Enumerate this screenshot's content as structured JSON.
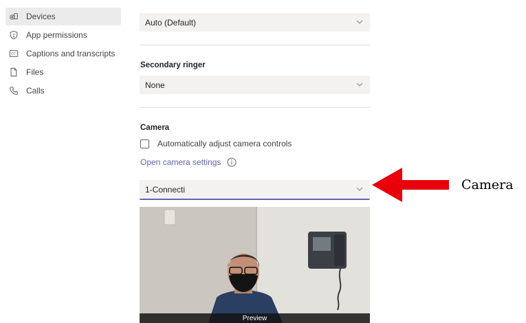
{
  "sidebar": {
    "items": [
      {
        "label": "Devices",
        "icon": "device-icon",
        "active": true
      },
      {
        "label": "App permissions",
        "icon": "shield-icon"
      },
      {
        "label": "Captions and transcripts",
        "icon": "captions-icon"
      },
      {
        "label": "Files",
        "icon": "file-icon"
      },
      {
        "label": "Calls",
        "icon": "phone-icon"
      }
    ]
  },
  "main": {
    "ringer_select": {
      "value": "Auto (Default)"
    },
    "secondary_ringer": {
      "title": "Secondary ringer",
      "value": "None"
    },
    "camera": {
      "title": "Camera",
      "auto_adjust_label": "Automatically adjust camera controls",
      "auto_adjust_checked": false,
      "open_settings_link": "Open camera settings",
      "device_value": "1-Connecti",
      "preview_label": "Preview"
    }
  },
  "annotation": {
    "label": "Camera",
    "arrow_color": "#e8000b"
  },
  "colors": {
    "accent": "#6264a7",
    "select_bg": "#f3f2f1",
    "sidebar_active": "#ebebeb"
  }
}
